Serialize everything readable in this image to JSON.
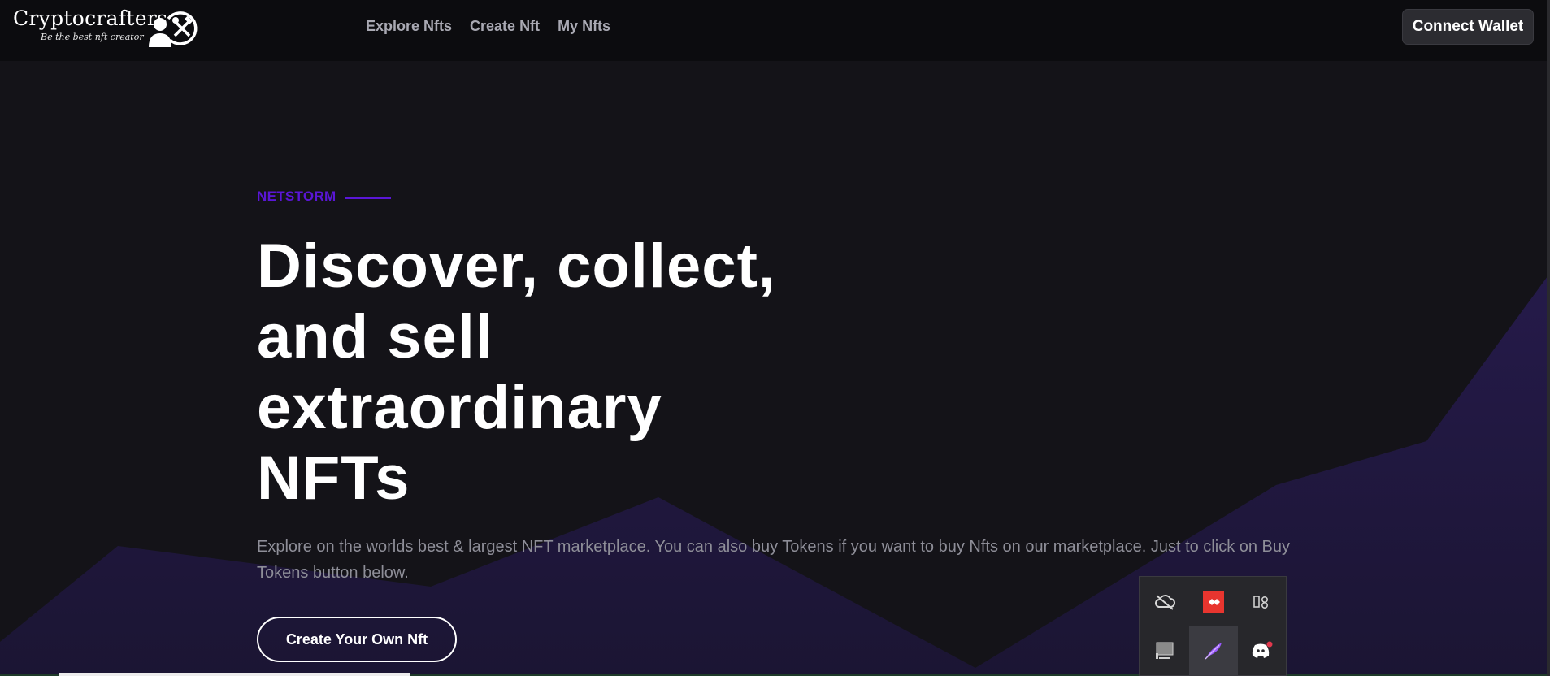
{
  "header": {
    "brand_name": "Cryptocrafters",
    "brand_tagline": "Be the best nft creator",
    "nav": [
      "Explore Nfts",
      "Create Nft",
      "My Nfts"
    ],
    "connect_label": "Connect Wallet"
  },
  "hero": {
    "eyebrow": "NETSTORM",
    "headline_lines": [
      "Discover, collect,",
      "and sell",
      "extraordinary",
      "NFTs"
    ],
    "lead": "Explore on the worlds best & largest NFT marketplace. You can also buy Tokens if you want to buy Nfts on our marketplace. Just to click on Buy Tokens button below.",
    "cta_label": "Create Your Own Nft"
  },
  "system_tray": {
    "icons": [
      "cloud-offline-icon",
      "anydesk-icon",
      "bluetooth-binary-icon",
      "monitor-icon",
      "feather-icon",
      "discord-icon"
    ],
    "active_index": 4
  },
  "colors": {
    "accent": "#5a16d6",
    "background": "#141318",
    "header": "#0c0c0f",
    "mountain": "#22183f"
  }
}
